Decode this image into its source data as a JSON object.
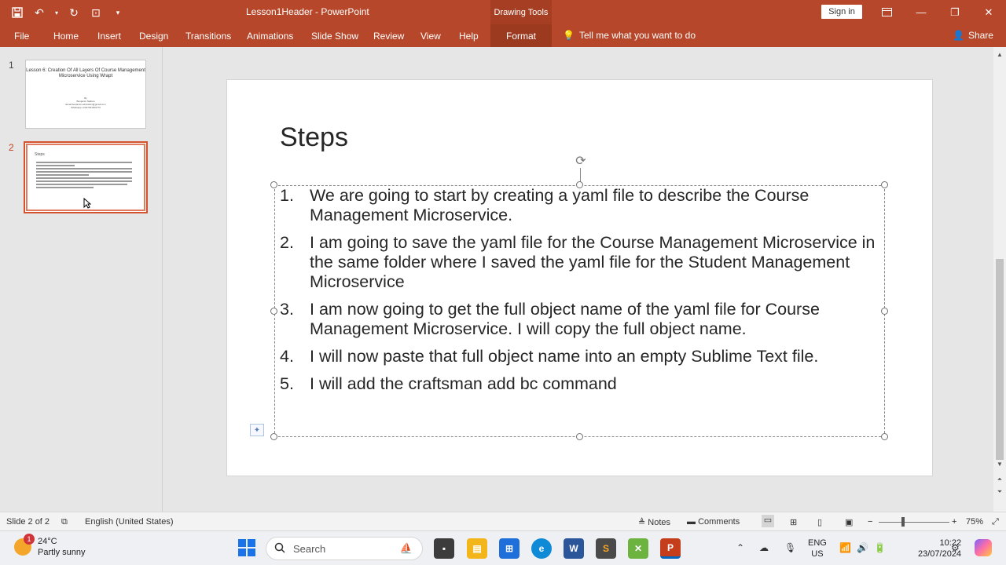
{
  "titlebar": {
    "doc_title": "Lesson1Header  -  PowerPoint",
    "context_tab_group": "Drawing Tools",
    "signin_label": "Sign in"
  },
  "ribbon": {
    "tabs": [
      "File",
      "Home",
      "Insert",
      "Design",
      "Transitions",
      "Animations",
      "Slide Show",
      "Review",
      "View",
      "Help"
    ],
    "context_tab": "Format",
    "tell_me": "Tell me what you want to do",
    "share": "Share"
  },
  "thumbnails": {
    "slide1": {
      "number": "1",
      "title": "Lesson 6: Creation Of All Layers Of Course Management Microservice Using Wrapt",
      "subtitle_lines": [
        "By",
        "Benjamin Nathan",
        "Email:benjamin.education@gmail.com",
        "Whatsapp:+2347031819776"
      ]
    },
    "slide2": {
      "number": "2",
      "title": "Steps"
    }
  },
  "slide": {
    "title": "Steps",
    "steps": [
      {
        "num": "1.",
        "text": "We are going to start by creating a yaml file to describe the Course Management Microservice."
      },
      {
        "num": "2.",
        "text": "I am going to save the yaml file for the Course Management Microservice in the same folder where I saved the yaml file for the Student Management Microservice"
      },
      {
        "num": "3.",
        "text": "I am now going to get the full object name of the yaml file for Course Management Microservice. I will copy the full object name."
      },
      {
        "num": "4.",
        "text": "I will now paste that full object name into an empty Sublime Text file."
      },
      {
        "num": "5.",
        "text": "I will add the craftsman add bc command"
      }
    ]
  },
  "statusbar": {
    "slide_info": "Slide 2 of 2",
    "language": "English (United States)",
    "notes": "Notes",
    "comments": "Comments",
    "zoom": "75%"
  },
  "taskbar": {
    "weather_badge": "1",
    "temperature": "24°C",
    "condition": "Partly sunny",
    "search_placeholder": "Search",
    "lang_line1": "ENG",
    "lang_line2": "US",
    "time": "10:22",
    "date": "23/07/2024"
  }
}
